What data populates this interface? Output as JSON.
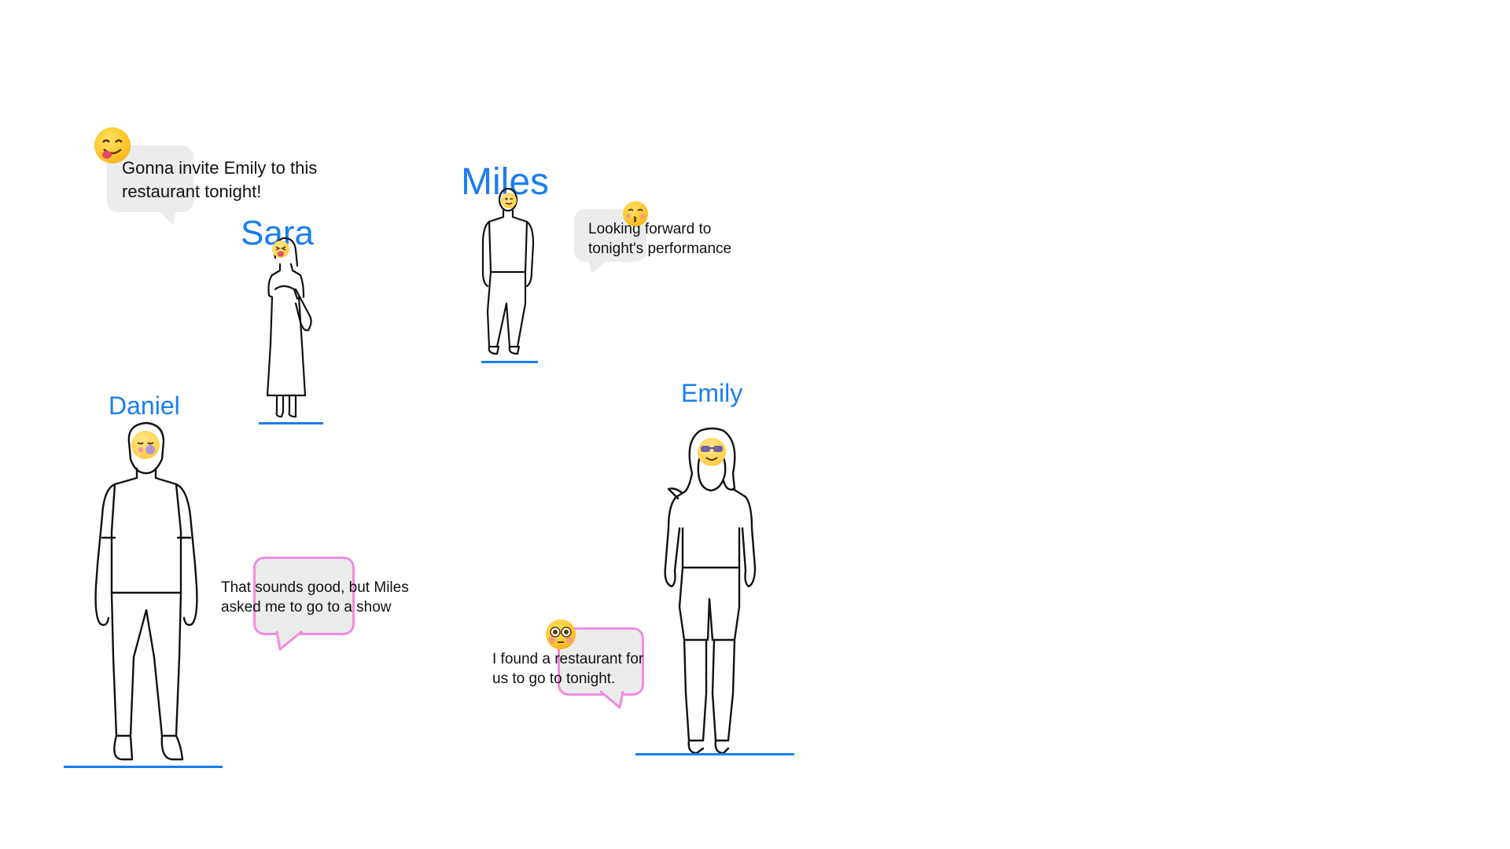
{
  "accent_color": "#1a7ef0",
  "bubble_highlight_color": "#ee8ee0",
  "characters": {
    "miles": {
      "name": "Miles",
      "face_icon": "winking-face-icon"
    },
    "sara": {
      "name": "Sara",
      "face_icon": "face-with-tongue-icon"
    },
    "daniel": {
      "name": "Daniel",
      "face_icon": "sleepy-blushing-face-icon"
    },
    "emily": {
      "name": "Emily",
      "face_icon": "smiling-face-with-sunglasses-icon"
    }
  },
  "bubbles": {
    "sara_thought": {
      "line1": "Gonna invite Emily to this",
      "line2": "restaurant tonight!",
      "emoji": "face-savoring-food-icon"
    },
    "miles_thought": {
      "line1": "Looking forward to",
      "line2": "tonight's performance",
      "emoji": "kissing-face-with-closed-eyes-icon"
    },
    "daniel_reply": {
      "line1": "That sounds good, but Miles",
      "line2": "asked me to go to a show",
      "highlighted": true
    },
    "emily_message": {
      "line1": "I found a restaurant for",
      "line2": "us to go to tonight.",
      "emoji": "flushed-face-icon",
      "highlighted": true
    }
  }
}
